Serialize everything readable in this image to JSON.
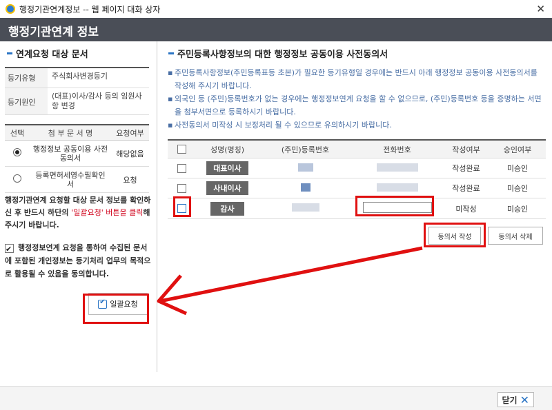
{
  "window": {
    "title": "행정기관연계정보 -- 웹 페이지 대화 상자"
  },
  "header": {
    "title": "행정기관연계 정보"
  },
  "left": {
    "section_title": "연계요청 대상 문서",
    "info": [
      {
        "label": "등기유형",
        "value": "주식회사변경등기"
      },
      {
        "label": "등기원인",
        "value": "(대표)이사/감사 등의 임원사항 변경"
      }
    ],
    "attach_headers": {
      "select": "선택",
      "name": "첨 부 문 서 명",
      "required": "요청여부"
    },
    "attachments": [
      {
        "name": "행정정보 공동이용 사전동의서",
        "status": "해당없음",
        "selected": true
      },
      {
        "name": "등록면허세영수필확인서",
        "status": "요청",
        "selected": false
      }
    ],
    "notice_1": "행정기관연계 요청할 대상 문서 정보를 확인하신 후 반드시 하단의 ",
    "notice_red": "'일괄요청' 버튼을 클릭",
    "notice_2": "해 주시기 바랍니다.",
    "consent_text": "행정정보연계 요청을 통하여 수집된 문서에 포함된 개인정보는 등기처리 업무의 목적으로 활용될 수 있음을 동의합니다.",
    "bulk_button": "일괄요청"
  },
  "right": {
    "section_title": "주민등록사항정보의 대한 행정정보 공동이용 사전동의서",
    "bullets": [
      "주민등록사항정보(주민등록표등 초본)가 필요한 등기유형일 경우에는 반드시 아래 행정정보 공동이용 사전동의서를 작성해 주시기 바랍니다.",
      "외국인 등 (주민)등록번호가 없는 경우에는 행정정보연계 요청을 할 수 없으므로, (주민)등록번호 등을 증명하는 서면을 첨부서면으로 등록하시기 바랍니다.",
      "사전동의서 미작성 시 보정처리 될 수 있으므로 유의하시기 바랍니다."
    ],
    "columns": [
      "성명(명칭)",
      "(주민)등록번호",
      "전화번호",
      "작성여부",
      "승인여부"
    ],
    "rows": [
      {
        "role": "대표이사",
        "written": "작성완료",
        "approval": "미승인"
      },
      {
        "role": "사내이사",
        "written": "작성완료",
        "approval": "미승인"
      },
      {
        "role": "감사",
        "written": "미작성",
        "approval": "미승인"
      }
    ],
    "write_button": "동의서 작성",
    "delete_button": "동의서 삭제"
  },
  "footer": {
    "close_button": "닫기"
  }
}
